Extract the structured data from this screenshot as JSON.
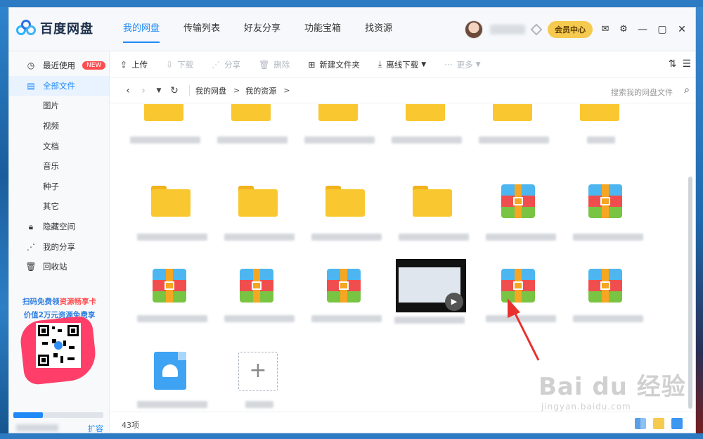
{
  "app": {
    "name": "百度网盘",
    "nav_tabs": [
      {
        "label": "我的网盘",
        "active": true
      },
      {
        "label": "传输列表",
        "active": false
      },
      {
        "label": "好友分享",
        "active": false
      },
      {
        "label": "功能宝箱",
        "active": false
      },
      {
        "label": "找资源",
        "active": false
      }
    ],
    "vip_button": "会员中心",
    "accent": "#1f8af7"
  },
  "sidebar": {
    "items": [
      {
        "label": "最近使用",
        "icon": "clock-icon",
        "badge": "NEW"
      },
      {
        "label": "全部文件",
        "icon": "document-icon",
        "active": true
      },
      {
        "label": "图片"
      },
      {
        "label": "视频"
      },
      {
        "label": "文档"
      },
      {
        "label": "音乐"
      },
      {
        "label": "种子"
      },
      {
        "label": "其它"
      },
      {
        "label": "隐藏空间",
        "icon": "lock-icon"
      },
      {
        "label": "我的分享",
        "icon": "share-icon"
      },
      {
        "label": "回收站",
        "icon": "trash-icon"
      }
    ],
    "promo_line1_a": "扫码免费领",
    "promo_line1_b": "资源畅享卡",
    "promo_line2": "价值2万元资源免费享",
    "quota_fraction": 0.33,
    "expand_label": "扩容"
  },
  "toolbar": {
    "upload": "上传",
    "download": "下载",
    "share": "分享",
    "delete": "删除",
    "new_folder": "新建文件夹",
    "offline_download": "离线下载",
    "more": "更多"
  },
  "pathbar": {
    "crumbs": [
      "我的网盘",
      "我的资源"
    ],
    "search_placeholder": "搜索我的网盘文件"
  },
  "status": {
    "count": "43项"
  },
  "watermark": {
    "main": "Bai du 经验",
    "sub": "jingyan.baidu.com"
  }
}
